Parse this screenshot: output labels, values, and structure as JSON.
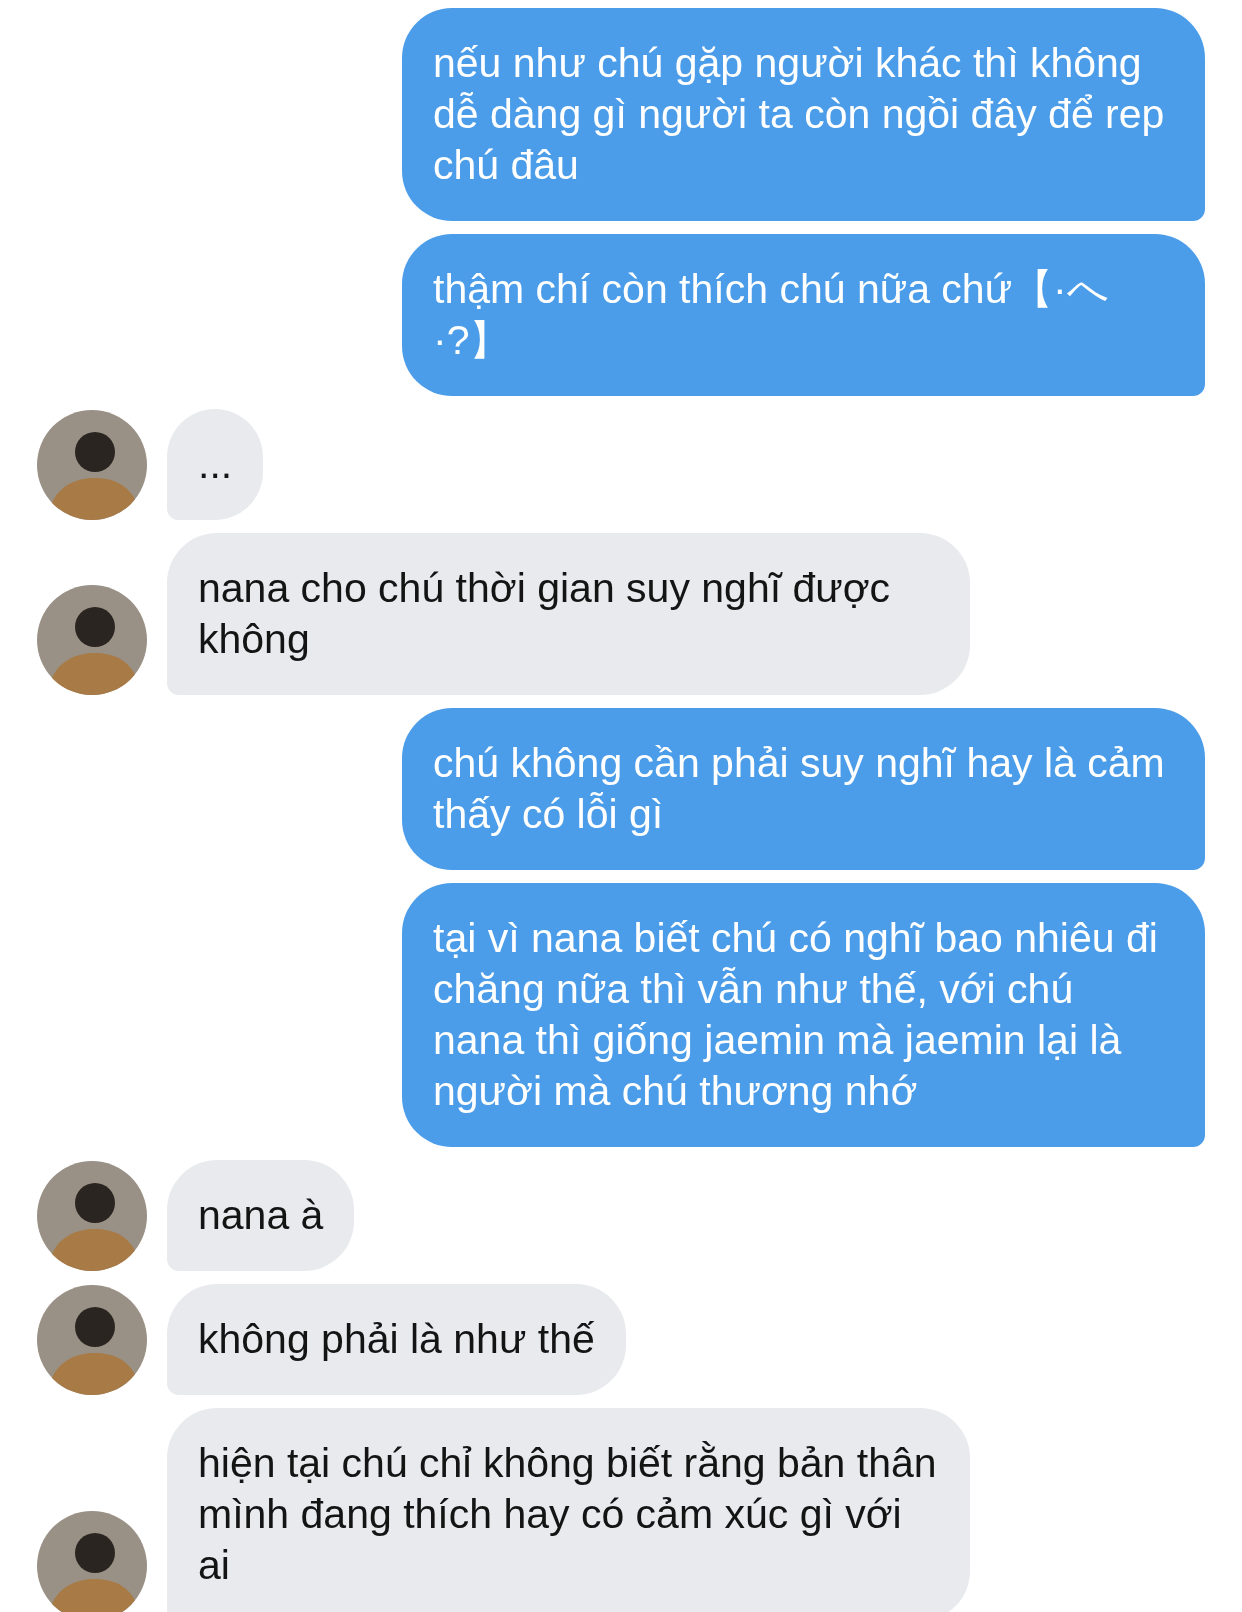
{
  "messages": [
    {
      "kind": "me",
      "text": "nếu như chú gặp người khác thì không dễ dàng gì người ta còn ngồi đây để rep chú đâu"
    },
    {
      "kind": "me",
      "text": "thậm chí còn thích chú nữa chứ【·へ·?】"
    },
    {
      "kind": "them",
      "text": "..."
    },
    {
      "kind": "them",
      "text": "nana cho chú thời gian suy nghĩ được không"
    },
    {
      "kind": "me",
      "text": "chú không cần phải suy nghĩ hay là cảm thấy có lỗi gì"
    },
    {
      "kind": "me",
      "text": "tại vì nana biết chú có nghĩ bao nhiêu đi chăng nữa thì vẫn như thế, với chú nana thì giống jaemin mà jaemin lại là người mà chú thương nhớ"
    },
    {
      "kind": "them",
      "text": "nana à"
    },
    {
      "kind": "them",
      "text": "không phải là như thế"
    },
    {
      "kind": "them",
      "text": "hiện tại chú chỉ không biết rằng bản thân mình đang thích hay có cảm xúc gì với ai"
    }
  ]
}
